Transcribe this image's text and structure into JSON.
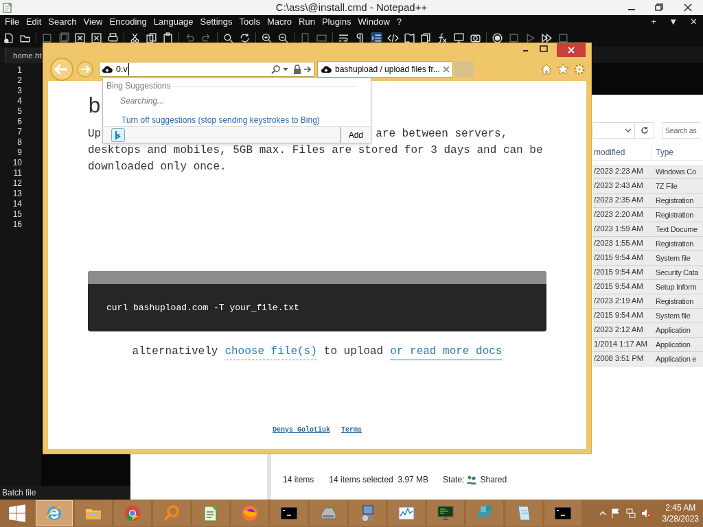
{
  "notepad": {
    "title": "C:\\ass\\@install.cmd - Notepad++",
    "menu": [
      "File",
      "Edit",
      "Search",
      "View",
      "Encoding",
      "Language",
      "Settings",
      "Tools",
      "Macro",
      "Run",
      "Plugins",
      "Window",
      "?"
    ],
    "menu_right": [
      "+",
      "▼",
      "✕"
    ],
    "tab": "home.ht",
    "line_numbers": [
      "1",
      "2",
      "3",
      "4",
      "5",
      "6",
      "7",
      "8",
      "9",
      "10",
      "11",
      "12",
      "13",
      "14",
      "15",
      "16"
    ],
    "status": "Batch file"
  },
  "explorer": {
    "search_placeholder": "Search as",
    "columns": [
      "modified",
      "Type"
    ],
    "rows": [
      {
        "modified": "/2023 2:23 AM",
        "type": "Windows Co",
        "selected": true
      },
      {
        "modified": "/2023 2:43 AM",
        "type": "7Z File",
        "selected": true
      },
      {
        "modified": "/2023 2:35 AM",
        "type": "Registration",
        "selected": true
      },
      {
        "modified": "/2023 2:20 AM",
        "type": "Registration",
        "selected": true
      },
      {
        "modified": "/2023 1:59 AM",
        "type": "Text Docume",
        "selected": true
      },
      {
        "modified": "/2023 1:55 AM",
        "type": "Registration",
        "selected": true
      },
      {
        "modified": "/2015 9:54 AM",
        "type": "System file",
        "selected": true
      },
      {
        "modified": "/2015 9:54 AM",
        "type": "Security Cata",
        "selected": true
      },
      {
        "modified": "/2015 9:54 AM",
        "type": "Setup Inform",
        "selected": true
      },
      {
        "modified": "/2023 2:19 AM",
        "type": "Registration",
        "selected": true
      },
      {
        "modified": "/2015 9:54 AM",
        "type": "System file",
        "selected": true
      },
      {
        "modified": "/2023 2:12 AM",
        "type": "Application",
        "selected": true
      },
      {
        "modified": "1/2014 1:17 AM",
        "type": "Application",
        "selected": true
      },
      {
        "modified": "/2008 3:51 PM",
        "type": "Application e",
        "selected": true
      }
    ],
    "status": {
      "count": "14 items",
      "selection": "14 items selected  3.97 MB",
      "state_label": "State:",
      "state": "Shared"
    }
  },
  "browser": {
    "address": "0.v",
    "tab": "bashupload / upload files fr...",
    "suggestions": {
      "header": "Bing Suggestions",
      "status": "Searching...",
      "link": "Turn off suggestions (stop sending keystrokes to Bing)",
      "add": "Add"
    },
    "page": {
      "heading": "b",
      "line_1_start": "Up",
      "line_1_end": "are between servers,",
      "line_2": "desktops and mobiles, 5GB max. Files are stored for 3 days and can be",
      "line_3": "downloaded only once.",
      "command": "curl bashupload.com -T your_file.txt",
      "alt_prefix": "alternatively",
      "alt_link": "choose file(s)",
      "alt_middle": "to upload",
      "alt_docs": "or read more docs",
      "footer": [
        "Denys Golotiuk",
        "Terms"
      ]
    }
  },
  "taskbar": {
    "apps": [
      {
        "kind": "ie",
        "selected": true
      },
      {
        "kind": "folder",
        "selected": false
      },
      {
        "kind": "chrome",
        "selected": false
      },
      {
        "kind": "magnifier",
        "selected": false
      },
      {
        "kind": "notepadpp",
        "selected": false
      },
      {
        "kind": "firefox",
        "selected": false
      },
      {
        "kind": "console",
        "selected": false
      },
      {
        "kind": "drive",
        "selected": false
      },
      {
        "kind": "installer",
        "selected": false
      },
      {
        "kind": "chart",
        "selected": false
      },
      {
        "kind": "monitor",
        "selected": false
      },
      {
        "kind": "cubes",
        "selected": false
      },
      {
        "kind": "notepad",
        "selected": false
      },
      {
        "kind": "console",
        "selected": false
      }
    ],
    "time": "2:45 AM",
    "date": "3/28/2023"
  }
}
